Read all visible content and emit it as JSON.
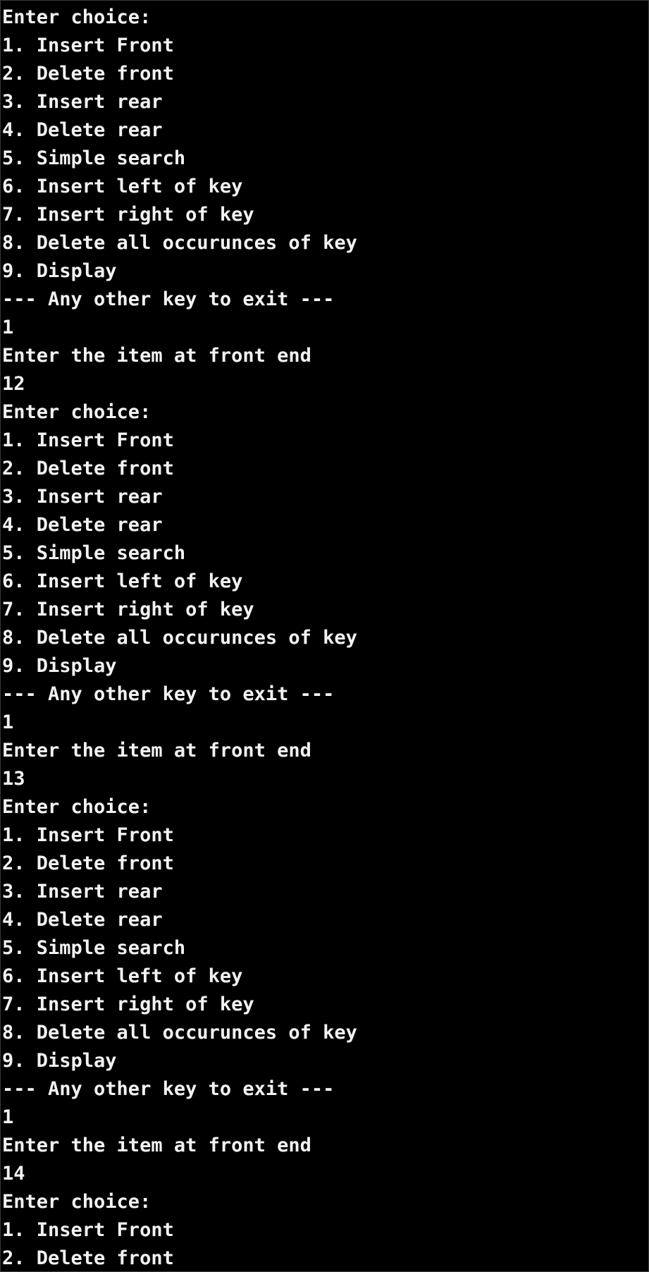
{
  "terminal": {
    "lines": [
      {
        "text": "Enter choice:",
        "kind": "prompt"
      },
      {
        "text": "1. Insert Front",
        "kind": "menu"
      },
      {
        "text": "2. Delete front",
        "kind": "menu"
      },
      {
        "text": "3. Insert rear",
        "kind": "menu"
      },
      {
        "text": "4. Delete rear",
        "kind": "menu"
      },
      {
        "text": "5. Simple search",
        "kind": "menu"
      },
      {
        "text": "6. Insert left of key",
        "kind": "menu"
      },
      {
        "text": "7. Insert right of key",
        "kind": "menu"
      },
      {
        "text": "8. Delete all occurunces of key",
        "kind": "menu"
      },
      {
        "text": "9. Display",
        "kind": "menu"
      },
      {
        "text": "--- Any other key to exit ---",
        "kind": "menu"
      },
      {
        "text": "1",
        "kind": "input"
      },
      {
        "text": "Enter the item at front end",
        "kind": "prompt"
      },
      {
        "text": "12",
        "kind": "input"
      },
      {
        "text": "Enter choice:",
        "kind": "prompt"
      },
      {
        "text": "1. Insert Front",
        "kind": "menu"
      },
      {
        "text": "2. Delete front",
        "kind": "menu"
      },
      {
        "text": "3. Insert rear",
        "kind": "menu"
      },
      {
        "text": "4. Delete rear",
        "kind": "menu"
      },
      {
        "text": "5. Simple search",
        "kind": "menu"
      },
      {
        "text": "6. Insert left of key",
        "kind": "menu"
      },
      {
        "text": "7. Insert right of key",
        "kind": "menu"
      },
      {
        "text": "8. Delete all occurunces of key",
        "kind": "menu"
      },
      {
        "text": "9. Display",
        "kind": "menu"
      },
      {
        "text": "--- Any other key to exit ---",
        "kind": "menu"
      },
      {
        "text": "1",
        "kind": "input"
      },
      {
        "text": "Enter the item at front end",
        "kind": "prompt"
      },
      {
        "text": "13",
        "kind": "input"
      },
      {
        "text": "Enter choice:",
        "kind": "prompt"
      },
      {
        "text": "1. Insert Front",
        "kind": "menu"
      },
      {
        "text": "2. Delete front",
        "kind": "menu"
      },
      {
        "text": "3. Insert rear",
        "kind": "menu"
      },
      {
        "text": "4. Delete rear",
        "kind": "menu"
      },
      {
        "text": "5. Simple search",
        "kind": "menu"
      },
      {
        "text": "6. Insert left of key",
        "kind": "menu"
      },
      {
        "text": "7. Insert right of key",
        "kind": "menu"
      },
      {
        "text": "8. Delete all occurunces of key",
        "kind": "menu"
      },
      {
        "text": "9. Display",
        "kind": "menu"
      },
      {
        "text": "--- Any other key to exit ---",
        "kind": "menu"
      },
      {
        "text": "1",
        "kind": "input"
      },
      {
        "text": "Enter the item at front end",
        "kind": "prompt"
      },
      {
        "text": "14",
        "kind": "input"
      },
      {
        "text": "Enter choice:",
        "kind": "prompt"
      },
      {
        "text": "1. Insert Front",
        "kind": "menu"
      },
      {
        "text": "2. Delete front",
        "kind": "menu"
      }
    ]
  },
  "colors": {
    "background": "#000000",
    "foreground": "#f2f2f2"
  }
}
